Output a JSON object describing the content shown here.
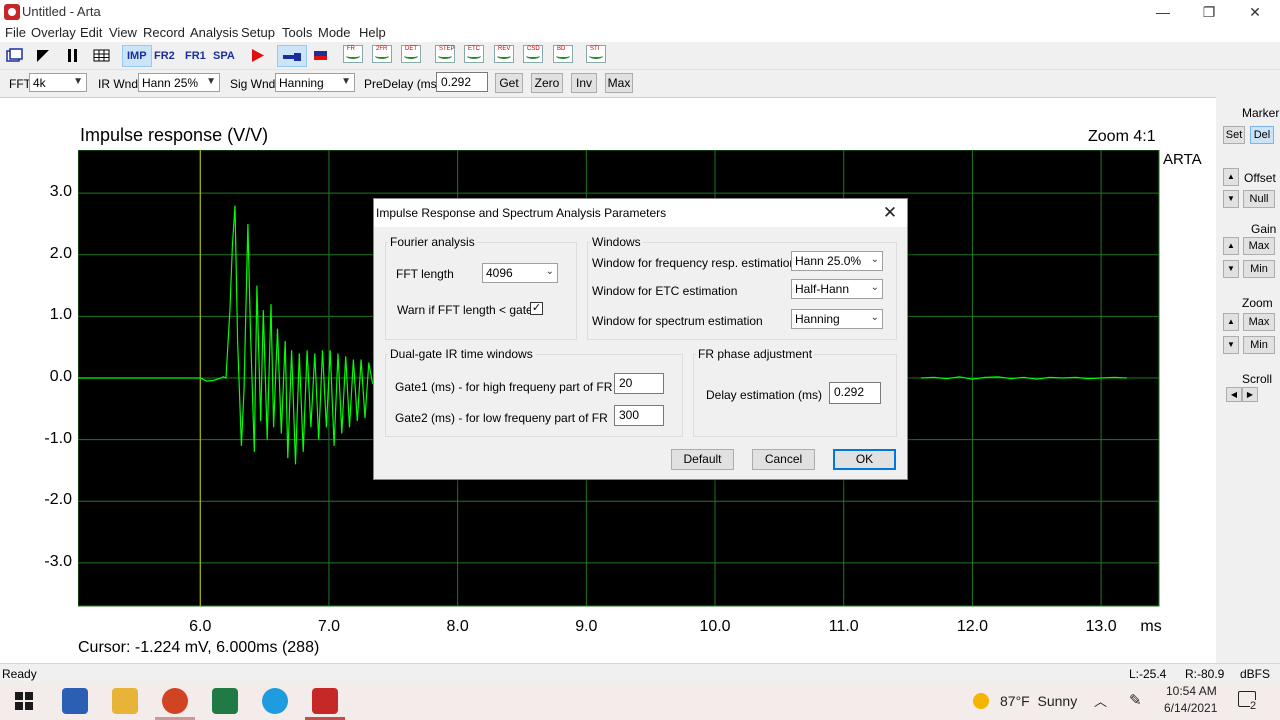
{
  "window": {
    "title": "Untitled - Arta"
  },
  "menu": [
    "File",
    "Overlay",
    "Edit",
    "View",
    "Record",
    "Analysis",
    "Setup",
    "Tools",
    "Mode",
    "Help"
  ],
  "toolbar": {
    "modes": [
      "IMP",
      "FR2",
      "FR1",
      "SPA"
    ],
    "minis": [
      "FR",
      "2FR",
      "DET",
      "STEP",
      "ETC",
      "REV",
      "CSD",
      "BD",
      "STI"
    ]
  },
  "toolbar2": {
    "fft_label": "FFT",
    "fft_value": "4k",
    "irwnd_label": "IR Wnd",
    "irwnd_value": "Hann 25%",
    "sigwnd_label": "Sig Wnd",
    "sigwnd_value": "Hanning",
    "predelay_label": "PreDelay (ms)",
    "predelay_value": "0.292",
    "get": "Get",
    "zero": "Zero",
    "inv": "Inv",
    "max": "Max"
  },
  "chart_data": {
    "type": "line",
    "title": "Impulse response (V/V)",
    "xlabel": "ms",
    "ylabel": "",
    "xlim": [
      5.05,
      13.45
    ],
    "ylim": [
      -3.7,
      3.7
    ],
    "xticks": [
      "6.0",
      "7.0",
      "8.0",
      "9.0",
      "10.0",
      "11.0",
      "12.0",
      "13.0"
    ],
    "yticks": [
      "3.0",
      "2.0",
      "1.0",
      "0.0",
      "-1.0",
      "-2.0",
      "-3.0"
    ],
    "grid": true,
    "background": "#000000",
    "grid_color": "#1e7a1e",
    "line_color": "#00ff00",
    "cursor_x": 6.0,
    "cursor_color": "#c8c800",
    "series": [
      {
        "x": [
          5.05,
          5.6,
          6.0,
          6.05,
          6.1,
          6.15,
          6.18,
          6.2,
          6.23,
          6.25,
          6.27,
          6.29,
          6.32,
          6.34,
          6.37,
          6.39,
          6.42,
          6.44,
          6.47,
          6.49,
          6.52,
          6.55,
          6.57,
          6.6,
          6.63,
          6.66,
          6.68,
          6.71,
          6.74,
          6.77,
          6.8,
          6.83,
          6.86,
          6.89,
          6.92,
          6.95,
          6.98,
          7.01,
          7.04,
          7.07,
          7.1,
          7.13,
          7.16,
          7.19,
          7.22,
          7.25,
          7.28,
          7.31,
          7.34
        ],
        "y": [
          0.0,
          0.0,
          0.0,
          -0.05,
          -0.04,
          -0.01,
          0.02,
          0.0,
          1.1,
          2.15,
          2.8,
          0.6,
          -1.1,
          -0.2,
          2.5,
          0.8,
          -1.2,
          1.5,
          -0.7,
          1.1,
          -1.0,
          1.2,
          -0.8,
          0.8,
          -0.9,
          0.6,
          -1.3,
          0.45,
          -1.4,
          0.4,
          -1.2,
          0.45,
          -0.8,
          0.4,
          -1.0,
          0.45,
          -0.8,
          0.45,
          -1.1,
          0.4,
          -0.9,
          0.35,
          -0.8,
          0.3,
          -0.7,
          0.3,
          -0.65,
          0.25,
          -0.1
        ]
      },
      {
        "x": [
          11.6,
          11.7,
          11.8,
          11.9,
          12.0,
          12.1,
          12.2,
          12.3,
          12.4,
          12.5,
          12.6,
          12.7,
          12.8,
          12.9,
          13.0,
          13.1,
          13.2
        ],
        "y": [
          0.0,
          0.01,
          -0.01,
          0.02,
          -0.02,
          0.01,
          0.02,
          -0.01,
          0.01,
          -0.02,
          0.01,
          0.0,
          0.01,
          -0.01,
          0.0,
          0.01,
          0.0
        ]
      }
    ]
  },
  "plot": {
    "zoom": "Zoom 4:1",
    "brand": "ARTA",
    "cursor": "Cursor: -1.224 mV, 6.000ms (288)"
  },
  "right_panel": {
    "marker": "Marker",
    "set": "Set",
    "del": "Del",
    "offset": "Offset",
    "null": "Null",
    "gain": "Gain",
    "gain_max": "Max",
    "gain_min": "Min",
    "zoom": "Zoom",
    "zoom_max": "Max",
    "zoom_min": "Min",
    "scroll": "Scroll"
  },
  "status": {
    "ready": "Ready",
    "left": "L:-25.4",
    "right": "R:-80.9",
    "unit": "dBFS"
  },
  "taskbar": {
    "weather": "87°F  Sunny",
    "time": "10:54 AM",
    "date": "6/14/2021",
    "notifications": "2"
  },
  "dialog": {
    "title": "Impulse Response and Spectrum Analysis Parameters",
    "fourier": {
      "title": "Fourier analysis",
      "fft_length_label": "FFT length",
      "fft_length_value": "4096",
      "warn_label": "Warn if FFT length < gate",
      "warn_checked": "✓"
    },
    "windows": {
      "title": "Windows",
      "fr_label": "Window for frequency resp. estimation",
      "fr_value": "Hann 25.0%",
      "etc_label": "Window for ETC estimation",
      "etc_value": "Half-Hann",
      "spec_label": "Window for spectrum estimation",
      "spec_value": "Hanning"
    },
    "dual_gate": {
      "title": "Dual-gate IR time windows",
      "gate1_label": "Gate1 (ms) - for high frequeny part of FR",
      "gate1_value": "20",
      "gate2_label": "Gate2 (ms) - for low frequeny part of  FR",
      "gate2_value": "300"
    },
    "phase": {
      "title": "FR phase adjustment",
      "delay_label": "Delay estimation (ms)",
      "delay_value": "0.292"
    },
    "buttons": {
      "default": "Default",
      "cancel": "Cancel",
      "ok": "OK"
    }
  }
}
